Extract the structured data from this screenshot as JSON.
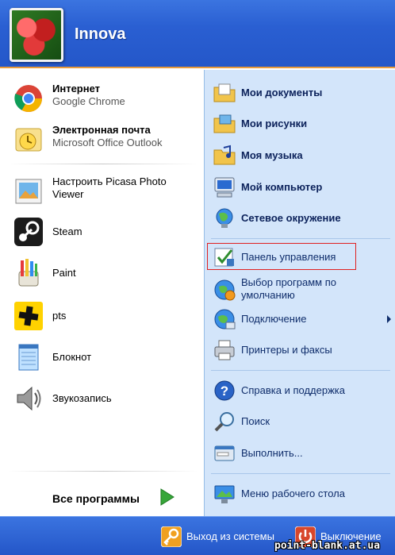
{
  "user": {
    "name": "Innova"
  },
  "left": {
    "pinned": [
      {
        "title": "Интернет",
        "subtitle": "Google Chrome",
        "icon": "chrome-icon"
      },
      {
        "title": "Электронная почта",
        "subtitle": "Microsoft Office Outlook",
        "icon": "outlook-icon"
      }
    ],
    "recent": [
      {
        "label": "Настроить Picasa Photo Viewer",
        "icon": "picasa-icon"
      },
      {
        "label": "Steam",
        "icon": "steam-icon"
      },
      {
        "label": "Paint",
        "icon": "paint-icon"
      },
      {
        "label": "pts",
        "icon": "pts-icon"
      },
      {
        "label": "Блокнот",
        "icon": "notepad-icon"
      },
      {
        "label": "Звукозапись",
        "icon": "sound-recorder-icon"
      }
    ],
    "all_programs": "Все программы"
  },
  "right": {
    "top": [
      {
        "label": "Мои документы",
        "icon": "my-documents-icon"
      },
      {
        "label": "Мои рисунки",
        "icon": "my-pictures-icon"
      },
      {
        "label": "Моя музыка",
        "icon": "my-music-icon"
      },
      {
        "label": "Мой компьютер",
        "icon": "my-computer-icon"
      },
      {
        "label": "Сетевое окружение",
        "icon": "network-places-icon"
      }
    ],
    "middle": [
      {
        "label": "Панель управления",
        "icon": "control-panel-icon"
      },
      {
        "label": "Выбор программ по умолчанию",
        "icon": "default-programs-icon"
      },
      {
        "label": "Подключение",
        "icon": "connect-icon"
      },
      {
        "label": "Принтеры и факсы",
        "icon": "printers-icon"
      }
    ],
    "bottom": [
      {
        "label": "Справка и поддержка",
        "icon": "help-icon"
      },
      {
        "label": "Поиск",
        "icon": "search-icon"
      },
      {
        "label": "Выполнить...",
        "icon": "run-icon"
      }
    ],
    "desktop_menu": {
      "label": "Меню рабочего стола",
      "icon": "desktop-menu-icon"
    }
  },
  "footer": {
    "logoff": "Выход из системы",
    "shutdown": "Выключение"
  },
  "watermark": "point-blank.at.ua",
  "colors": {
    "header_blue": "#2a5fd2",
    "right_panel": "#d3e5fa",
    "accent_orange": "#e89b3c",
    "highlight_red": "#e02020"
  }
}
